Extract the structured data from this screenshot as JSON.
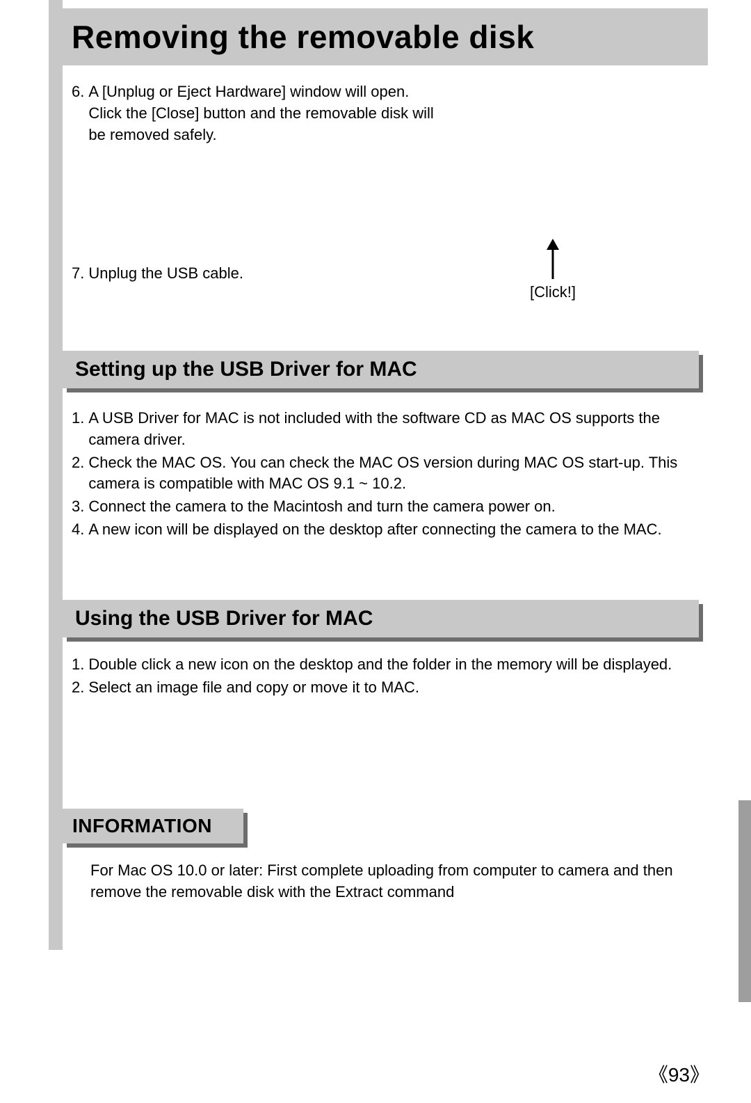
{
  "page_title": "Removing the removable disk",
  "step6": {
    "num": "6.",
    "text": "A [Unplug or Eject Hardware] window will open. Click the [Close] button and the removable disk will be removed safely."
  },
  "step7": {
    "num": "7.",
    "text": "Unplug the USB cable."
  },
  "click_label": "[Click!]",
  "section1": {
    "heading": "Setting up the USB Driver for MAC",
    "items": [
      {
        "num": "1.",
        "text": "A USB Driver for MAC is not included with the software CD as MAC OS supports the camera driver."
      },
      {
        "num": "2.",
        "text": "Check the MAC OS. You can check the MAC OS version during MAC OS start-up. This camera is compatible with MAC OS 9.1 ~ 10.2."
      },
      {
        "num": "3.",
        "text": "Connect the camera to the Macintosh and turn the camera power on."
      },
      {
        "num": "4.",
        "text": "A new icon will be displayed on the desktop after connecting the camera to the MAC."
      }
    ]
  },
  "section2": {
    "heading": "Using the USB Driver for MAC",
    "items": [
      {
        "num": "1.",
        "text": "Double click a new icon on the desktop and the folder in the memory will be displayed."
      },
      {
        "num": "2.",
        "text": "Select an image file and copy or move it to MAC."
      }
    ]
  },
  "information": {
    "heading": "INFORMATION",
    "text": "For Mac OS 10.0 or later: First complete uploading from computer to camera and then remove the removable disk with the Extract command"
  },
  "page_number": "《93》"
}
